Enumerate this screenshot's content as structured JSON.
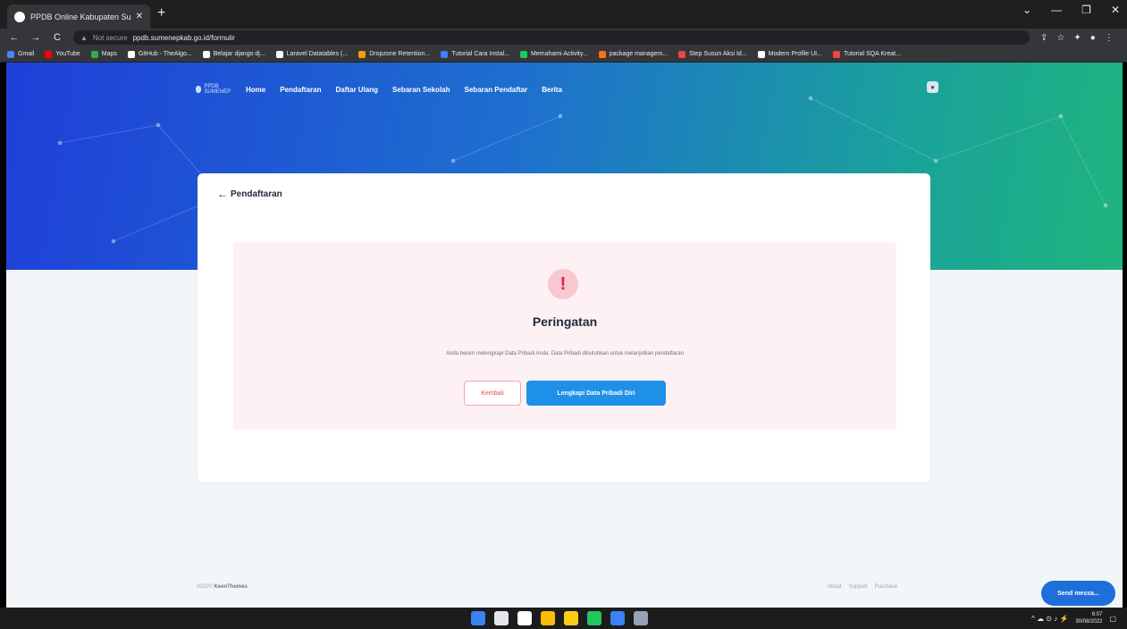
{
  "browser": {
    "tab_title": "PPDB Online Kabupaten Sumen...",
    "tab_close": "✕",
    "new_tab": "+",
    "window_controls": [
      "⌄",
      "—",
      "❐",
      "✕"
    ],
    "address_security": "Not secure",
    "address_url": "ppdb.sumenepkab.go.id/formulir",
    "nav_back": "←",
    "nav_forward": "→",
    "nav_reload": "C",
    "bookmarks": [
      {
        "label": "Gmail",
        "color": "#4285f4"
      },
      {
        "label": "YouTube",
        "color": "#ff0000"
      },
      {
        "label": "Maps",
        "color": "#34a853"
      },
      {
        "label": "GitHub - TheAlgo...",
        "color": "#ffffff"
      },
      {
        "label": "Belajar django dj...",
        "color": "#ffffff"
      },
      {
        "label": "Laravel Datatables (...",
        "color": "#ffffff"
      },
      {
        "label": "Dropzone Retention...",
        "color": "#f59e0b"
      },
      {
        "label": "Tutorial Cara Instal...",
        "color": "#3b82f6"
      },
      {
        "label": "Memahami Activity...",
        "color": "#22c55e"
      },
      {
        "label": "package managem...",
        "color": "#f97316"
      },
      {
        "label": "Step Susun Aksi Id...",
        "color": "#ef4444"
      },
      {
        "label": "Modern Profile UI...",
        "color": "#ffffff"
      },
      {
        "label": "Tutorial SQA Kreat...",
        "color": "#ef4444"
      }
    ]
  },
  "site": {
    "logo_text": "PPDB SUMENEP",
    "nav": [
      "Home",
      "Pendaftaran",
      "Daftar Ulang",
      "Sebaran Sekolah",
      "Sebaran Pendaftar",
      "Berita"
    ]
  },
  "card": {
    "back_icon": "←",
    "title": "Pendaftaran",
    "alert": {
      "icon": "!",
      "title": "Peringatan",
      "message": "Anda belum melengkapi Data Pribadi Anda. Data Pribadi dibutuhkan untuk melanjutkan pendaftaran",
      "back_label": "Kembali",
      "primary_label": "Lengkapi Data Pribadi Diri"
    }
  },
  "footer": {
    "copyright": "2022©",
    "brand": "KeenThemes",
    "links": [
      "About",
      "Support",
      "Purchase"
    ]
  },
  "chat": {
    "label": "Send messa..."
  },
  "taskbar": {
    "apps": [
      {
        "name": "windows",
        "color": "#3b82f6"
      },
      {
        "name": "search",
        "color": "#e5e7eb"
      },
      {
        "name": "task-view",
        "color": "#ffffff"
      },
      {
        "name": "chrome",
        "color": "#fbbc05"
      },
      {
        "name": "file-explorer",
        "color": "#facc15"
      },
      {
        "name": "whatsapp",
        "color": "#22c55e"
      },
      {
        "name": "vscode",
        "color": "#3b82f6"
      },
      {
        "name": "app",
        "color": "#94a3b8"
      }
    ],
    "tray_icons": "^  ☁  ⊙  ♪  ⚡",
    "time": "6:07",
    "date": "30/08/2022"
  }
}
